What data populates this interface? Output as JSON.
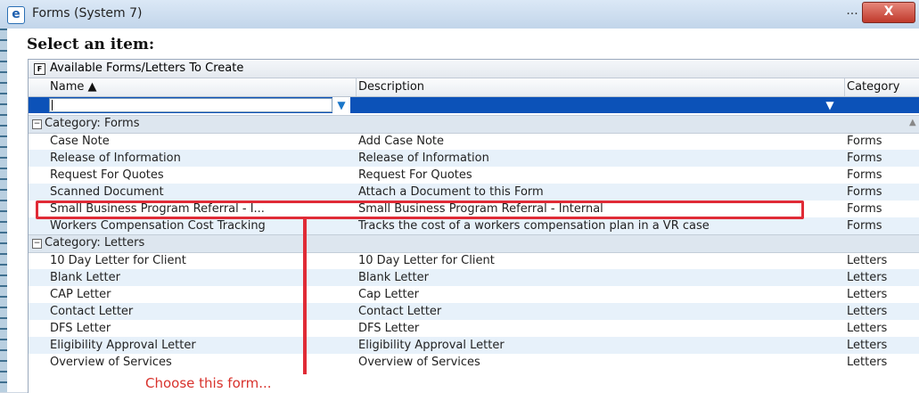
{
  "window": {
    "title": "Forms (System 7)",
    "minimize_glyph": "...",
    "close_glyph": "X",
    "icon": "ie-icon"
  },
  "heading": "Select an item:",
  "group": {
    "icon_glyph": "F",
    "title": "Available Forms/Letters To Create"
  },
  "columns": {
    "name": "Name ▲",
    "description": "Description",
    "category": "Category"
  },
  "categories": [
    {
      "label": "Category: Forms",
      "rows": [
        {
          "name": "Case Note",
          "description": "Add Case Note",
          "category": "Forms"
        },
        {
          "name": "Release of Information",
          "description": "Release of Information",
          "category": "Forms"
        },
        {
          "name": "Request For Quotes",
          "description": "Request For Quotes",
          "category": "Forms"
        },
        {
          "name": "Scanned Document",
          "description": "Attach a Document to this Form",
          "category": "Forms"
        },
        {
          "name": "Small Business Program Referral - I...",
          "description": "Small Business Program Referral - Internal",
          "category": "Forms"
        },
        {
          "name": "Workers Compensation Cost Tracking",
          "description": "Tracks the cost of a workers compensation plan in a VR case",
          "category": "Forms"
        }
      ]
    },
    {
      "label": "Category: Letters",
      "rows": [
        {
          "name": "10 Day Letter for Client",
          "description": "10 Day Letter for Client",
          "category": "Letters"
        },
        {
          "name": "Blank Letter",
          "description": "Blank Letter",
          "category": "Letters"
        },
        {
          "name": "CAP Letter",
          "description": "Cap Letter",
          "category": "Letters"
        },
        {
          "name": "Contact Letter",
          "description": "Contact Letter",
          "category": "Letters"
        },
        {
          "name": "DFS Letter",
          "description": "DFS Letter",
          "category": "Letters"
        },
        {
          "name": "Eligibility Approval Letter",
          "description": "Eligibility Approval Letter",
          "category": "Letters"
        },
        {
          "name": "Overview of Services",
          "description": "Overview of Services",
          "category": "Letters"
        }
      ]
    }
  ],
  "annotation": {
    "text": "Choose this form...",
    "color": "#e02b36"
  }
}
